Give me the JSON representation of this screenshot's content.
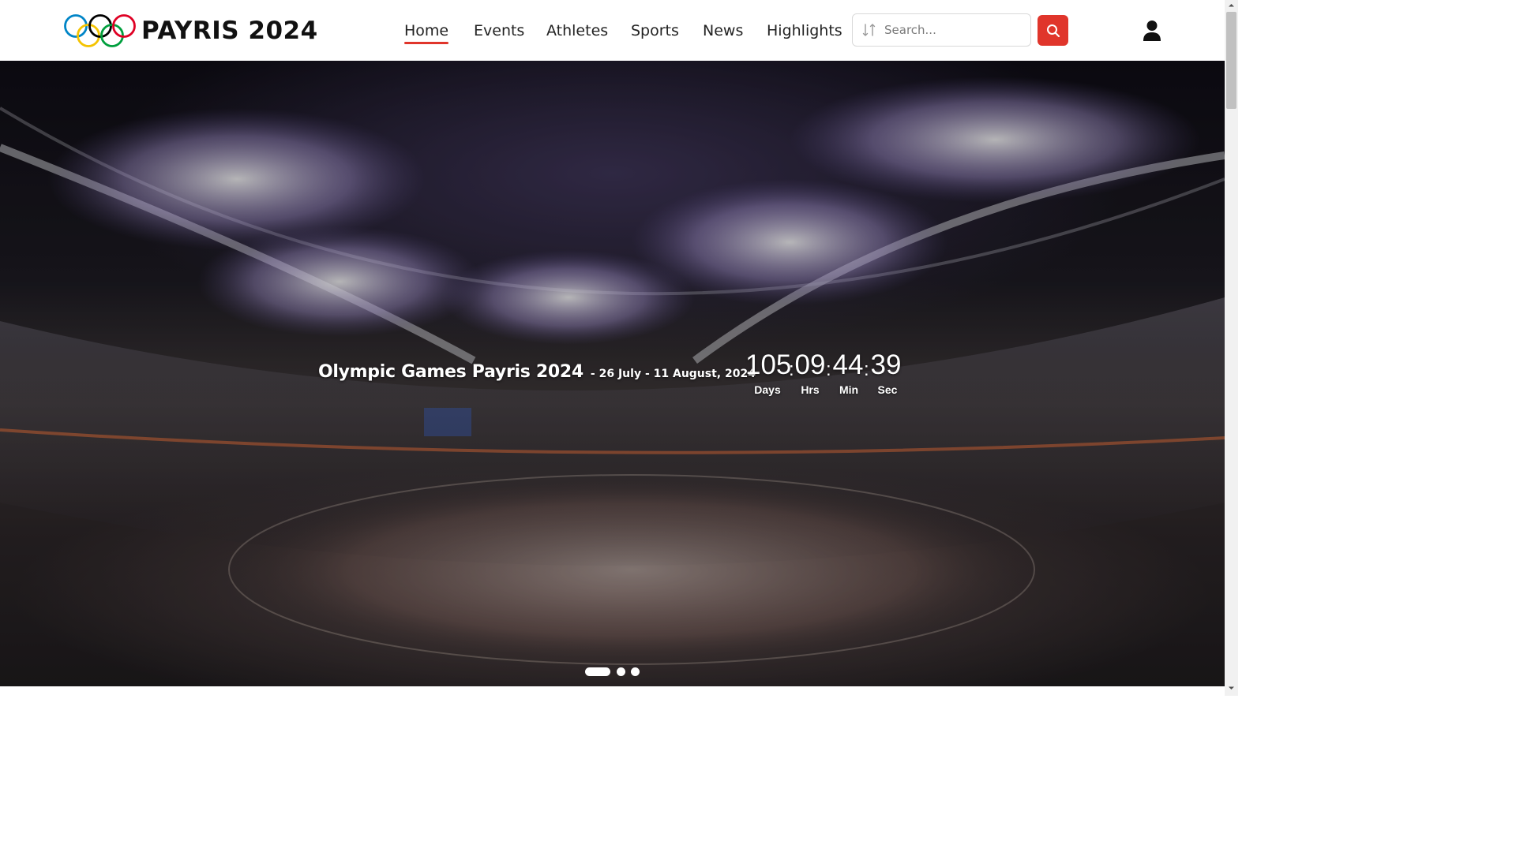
{
  "brand": {
    "name": "PAYRIS 2024",
    "ring_colors": [
      "#0085c7",
      "#f4c300",
      "#000000",
      "#009f3d",
      "#df0024"
    ]
  },
  "nav": {
    "items": [
      {
        "label": "Home",
        "active": true
      },
      {
        "label": "Events",
        "active": false
      },
      {
        "label": "Athletes",
        "active": false
      },
      {
        "label": "Sports",
        "active": false
      },
      {
        "label": "News",
        "active": false
      },
      {
        "label": "Highlights",
        "active": false
      }
    ]
  },
  "search": {
    "placeholder": "Search...",
    "value": "",
    "left_icon": "filter-icon",
    "button_icon": "search-icon"
  },
  "user": {
    "icon": "user-icon"
  },
  "hero": {
    "title": "Olympic Games Payris 2024",
    "dates": "- 26 July - 11 August, 2024",
    "image_subject": "stadium opening ceremony with fireworks",
    "countdown": {
      "days": "105",
      "hours": "09",
      "minutes": "44",
      "seconds": "39",
      "separator": ":",
      "labels": {
        "days": "Days",
        "hours": "Hrs",
        "minutes": "Min",
        "seconds": "Sec"
      }
    },
    "carousel": {
      "total_slides": 3,
      "active_slide": 1
    }
  },
  "colors": {
    "accent": "#e0352b",
    "text": "#222222"
  }
}
